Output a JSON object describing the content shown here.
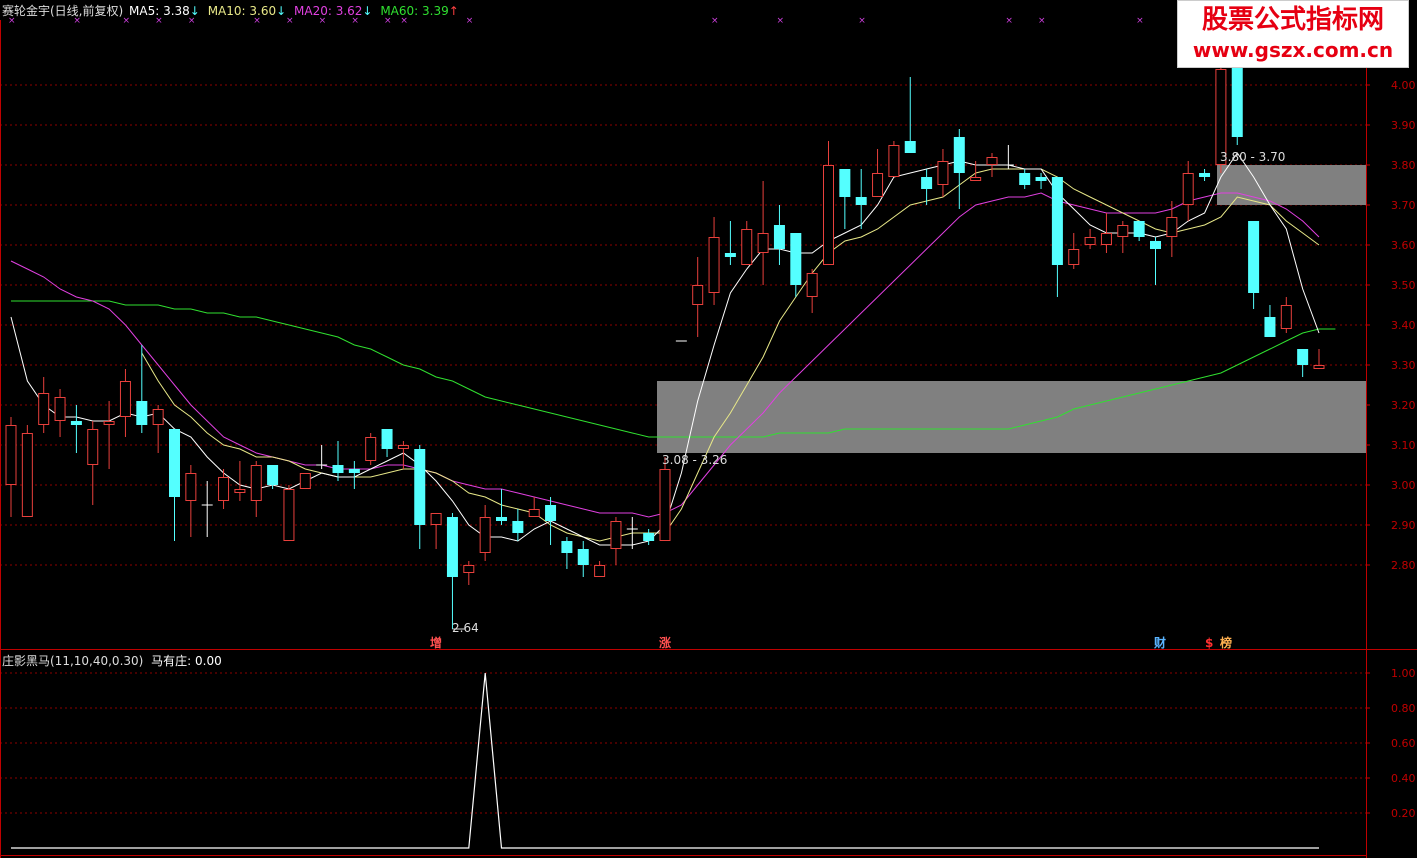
{
  "title_bar": {
    "stock_name": "赛轮金宇(日线,前复权)",
    "ma5": "MA5: 3.38",
    "ma10": "MA10: 3.60",
    "ma20": "MA20: 3.62",
    "ma60": "MA60: 3.39",
    "ma5_arrow": "↓",
    "ma10_arrow": "↓",
    "ma20_arrow": "↓",
    "ma60_arrow": "↑"
  },
  "colors": {
    "ma5": "#ffffff",
    "ma10": "#e8e888",
    "ma20": "#e040e0",
    "ma60": "#30e030",
    "up": "#e8403c",
    "down": "#54ffff",
    "grid": "#8b0000",
    "axis": "#c00000"
  },
  "watermark": {
    "line1": "股票公式指标网",
    "line2": "www.gszx.com.cn"
  },
  "price_axis": [
    "4.00",
    "3.90",
    "3.80",
    "3.70",
    "3.60",
    "3.50",
    "3.40",
    "3.30",
    "3.20",
    "3.10",
    "3.00",
    "2.90",
    "2.80"
  ],
  "indicator_axis": [
    "1.00",
    "0.80",
    "0.60",
    "0.40",
    "0.20"
  ],
  "zones": {
    "upper_label": "3.80 - 3.70",
    "lower_label": "3.08 - 3.26",
    "low_label": "2.64"
  },
  "event_markers": [
    {
      "text": "增"
    },
    {
      "text": "涨"
    },
    {
      "text": "财"
    },
    {
      "text": "$"
    },
    {
      "text": "榜"
    }
  ],
  "indicator": {
    "name": "庄影黑马(11,10,40,0.30)",
    "value": "马有庄: 0.00"
  },
  "candles": [
    [
      3.0,
      3.15,
      3.17,
      2.92
    ],
    [
      2.92,
      3.13,
      3.15,
      2.92
    ],
    [
      3.15,
      3.23,
      3.27,
      3.13
    ],
    [
      3.16,
      3.22,
      3.24,
      3.12
    ],
    [
      3.16,
      3.15,
      3.2,
      3.08
    ],
    [
      3.05,
      3.14,
      3.16,
      2.95
    ],
    [
      3.15,
      3.16,
      3.21,
      3.04
    ],
    [
      3.17,
      3.26,
      3.29,
      3.12
    ],
    [
      3.21,
      3.15,
      3.35,
      3.13
    ],
    [
      3.15,
      3.19,
      3.2,
      3.08
    ],
    [
      3.14,
      2.97,
      3.14,
      2.86
    ],
    [
      2.96,
      3.03,
      3.05,
      2.87
    ],
    [
      2.95,
      2.95,
      3.01,
      2.87
    ],
    [
      2.96,
      3.02,
      3.04,
      2.94
    ],
    [
      2.98,
      2.99,
      3.06,
      2.96
    ],
    [
      2.96,
      3.05,
      3.06,
      2.92
    ],
    [
      3.05,
      3.0,
      3.05,
      2.99
    ],
    [
      2.86,
      2.99,
      3.0,
      2.86
    ],
    [
      2.99,
      3.03,
      3.03,
      2.99
    ],
    [
      3.05,
      3.05,
      3.1,
      3.04
    ],
    [
      3.05,
      3.03,
      3.11,
      3.01
    ],
    [
      3.04,
      3.03,
      3.06,
      2.99
    ],
    [
      3.06,
      3.12,
      3.13,
      3.05
    ],
    [
      3.14,
      3.09,
      3.14,
      3.07
    ],
    [
      3.09,
      3.1,
      3.11,
      3.04
    ],
    [
      3.09,
      2.9,
      3.1,
      2.84
    ],
    [
      2.9,
      2.93,
      2.93,
      2.84
    ],
    [
      2.92,
      2.77,
      2.93,
      2.64
    ],
    [
      2.78,
      2.8,
      2.81,
      2.75
    ],
    [
      2.83,
      2.92,
      2.95,
      2.81
    ],
    [
      2.92,
      2.91,
      2.99,
      2.9
    ],
    [
      2.91,
      2.88,
      2.94,
      2.86
    ],
    [
      2.92,
      2.94,
      2.97,
      2.92
    ],
    [
      2.95,
      2.91,
      2.97,
      2.85
    ],
    [
      2.86,
      2.83,
      2.87,
      2.79
    ],
    [
      2.84,
      2.8,
      2.86,
      2.77
    ],
    [
      2.77,
      2.8,
      2.81,
      2.77
    ],
    [
      2.84,
      2.91,
      2.92,
      2.8
    ],
    [
      2.89,
      2.89,
      2.92,
      2.84
    ],
    [
      2.88,
      2.86,
      2.89,
      2.85
    ],
    [
      2.86,
      3.04,
      3.07,
      2.86
    ],
    [
      3.36,
      3.36,
      3.36,
      3.36
    ],
    [
      3.45,
      3.5,
      3.57,
      3.37
    ],
    [
      3.48,
      3.62,
      3.67,
      3.45
    ],
    [
      3.58,
      3.57,
      3.66,
      3.55
    ],
    [
      3.55,
      3.64,
      3.66,
      3.55
    ],
    [
      3.58,
      3.63,
      3.76,
      3.5
    ],
    [
      3.65,
      3.59,
      3.7,
      3.55
    ],
    [
      3.63,
      3.5,
      3.63,
      3.47
    ],
    [
      3.47,
      3.53,
      3.54,
      3.43
    ],
    [
      3.55,
      3.8,
      3.86,
      3.55
    ],
    [
      3.79,
      3.72,
      3.79,
      3.64
    ],
    [
      3.72,
      3.7,
      3.79,
      3.64
    ],
    [
      3.72,
      3.78,
      3.84,
      3.72
    ],
    [
      3.77,
      3.85,
      3.86,
      3.78
    ],
    [
      3.86,
      3.83,
      4.02,
      3.83
    ],
    [
      3.77,
      3.74,
      3.79,
      3.7
    ],
    [
      3.75,
      3.81,
      3.84,
      3.72
    ],
    [
      3.87,
      3.78,
      3.89,
      3.69
    ],
    [
      3.76,
      3.77,
      3.81,
      3.76
    ],
    [
      3.8,
      3.82,
      3.83,
      3.77
    ],
    [
      3.8,
      3.8,
      3.85,
      3.79
    ],
    [
      3.78,
      3.75,
      3.79,
      3.74
    ],
    [
      3.77,
      3.76,
      3.78,
      3.74
    ],
    [
      3.77,
      3.55,
      3.77,
      3.47
    ],
    [
      3.55,
      3.59,
      3.63,
      3.54
    ],
    [
      3.6,
      3.62,
      3.64,
      3.59
    ],
    [
      3.6,
      3.63,
      3.68,
      3.58
    ],
    [
      3.62,
      3.65,
      3.66,
      3.58
    ],
    [
      3.66,
      3.62,
      3.66,
      3.61
    ],
    [
      3.61,
      3.59,
      3.62,
      3.5
    ],
    [
      3.62,
      3.67,
      3.71,
      3.57
    ],
    [
      3.7,
      3.78,
      3.81,
      3.66
    ],
    [
      3.78,
      3.77,
      3.79,
      3.76
    ],
    [
      3.8,
      4.04,
      4.05,
      3.78
    ],
    [
      4.06,
      3.87,
      4.1,
      3.85
    ],
    [
      3.66,
      3.48,
      3.66,
      3.44
    ],
    [
      3.42,
      3.37,
      3.45,
      3.37
    ],
    [
      3.39,
      3.45,
      3.47,
      3.38
    ],
    [
      3.34,
      3.3,
      3.34,
      3.27
    ],
    [
      3.29,
      3.3,
      3.34,
      3.29
    ]
  ],
  "ma5_series": [
    3.42,
    3.26,
    3.2,
    3.17,
    3.17,
    3.16,
    3.16,
    3.18,
    3.17,
    3.18,
    3.14,
    3.12,
    3.07,
    3.03,
    3.0,
    2.99,
    3.0,
    2.99,
    3.01,
    3.03,
    3.02,
    3.02,
    3.04,
    3.06,
    3.08,
    3.05,
    3.01,
    2.96,
    2.9,
    2.87,
    2.87,
    2.86,
    2.89,
    2.91,
    2.89,
    2.87,
    2.85,
    2.85,
    2.85,
    2.86,
    2.9,
    3.03,
    3.21,
    3.35,
    3.48,
    3.54,
    3.59,
    3.59,
    3.58,
    3.58,
    3.61,
    3.63,
    3.65,
    3.7,
    3.77,
    3.78,
    3.79,
    3.8,
    3.81,
    3.8,
    3.8,
    3.8,
    3.79,
    3.79,
    3.73,
    3.69,
    3.65,
    3.63,
    3.63,
    3.63,
    3.62,
    3.63,
    3.66,
    3.68,
    3.77,
    3.83,
    3.77,
    3.7,
    3.64,
    3.49,
    3.38
  ],
  "ma10_series": [
    null,
    null,
    null,
    null,
    null,
    null,
    null,
    null,
    3.33,
    3.26,
    3.2,
    3.17,
    3.13,
    3.1,
    3.09,
    3.07,
    3.07,
    3.06,
    3.04,
    3.03,
    3.02,
    3.02,
    3.02,
    3.03,
    3.04,
    3.04,
    3.03,
    3.01,
    2.98,
    2.97,
    2.95,
    2.94,
    2.93,
    2.9,
    2.88,
    2.87,
    2.86,
    2.87,
    2.88,
    2.88,
    2.88,
    2.94,
    3.03,
    3.12,
    3.18,
    3.25,
    3.32,
    3.41,
    3.47,
    3.53,
    3.58,
    3.61,
    3.62,
    3.64,
    3.67,
    3.7,
    3.71,
    3.72,
    3.75,
    3.78,
    3.79,
    3.79,
    3.79,
    3.79,
    3.77,
    3.74,
    3.72,
    3.7,
    3.68,
    3.66,
    3.64,
    3.63,
    3.64,
    3.65,
    3.67,
    3.72,
    3.71,
    3.7,
    3.66,
    3.63,
    3.6
  ],
  "ma20_series": [
    3.56,
    3.54,
    3.52,
    3.49,
    3.47,
    3.46,
    3.44,
    3.4,
    3.35,
    3.3,
    3.25,
    3.2,
    3.16,
    3.12,
    3.1,
    3.08,
    3.07,
    3.06,
    3.05,
    3.05,
    3.04,
    3.04,
    3.04,
    3.05,
    3.05,
    3.04,
    3.03,
    3.01,
    3.0,
    2.99,
    2.99,
    2.98,
    2.97,
    2.96,
    2.95,
    2.94,
    2.93,
    2.93,
    2.93,
    2.92,
    2.93,
    2.95,
    3.0,
    3.05,
    3.1,
    3.14,
    3.18,
    3.23,
    3.27,
    3.31,
    3.35,
    3.39,
    3.43,
    3.47,
    3.51,
    3.55,
    3.59,
    3.63,
    3.67,
    3.7,
    3.71,
    3.72,
    3.72,
    3.73,
    3.71,
    3.7,
    3.69,
    3.68,
    3.68,
    3.68,
    3.68,
    3.69,
    3.71,
    3.72,
    3.73,
    3.73,
    3.72,
    3.71,
    3.69,
    3.66,
    3.62
  ],
  "ma60_series": [
    3.46,
    3.46,
    3.46,
    3.46,
    3.46,
    3.46,
    3.46,
    3.45,
    3.45,
    3.45,
    3.44,
    3.44,
    3.43,
    3.43,
    3.42,
    3.42,
    3.41,
    3.4,
    3.39,
    3.38,
    3.37,
    3.35,
    3.34,
    3.32,
    3.3,
    3.29,
    3.27,
    3.26,
    3.24,
    3.22,
    3.21,
    3.2,
    3.19,
    3.18,
    3.17,
    3.16,
    3.15,
    3.14,
    3.13,
    3.12,
    3.12,
    3.12,
    3.12,
    3.12,
    3.12,
    3.12,
    3.12,
    3.13,
    3.13,
    3.13,
    3.13,
    3.14,
    3.14,
    3.14,
    3.14,
    3.14,
    3.14,
    3.14,
    3.14,
    3.14,
    3.14,
    3.14,
    3.15,
    3.16,
    3.17,
    3.19,
    3.2,
    3.21,
    3.22,
    3.23,
    3.24,
    3.25,
    3.26,
    3.27,
    3.28,
    3.3,
    3.32,
    3.34,
    3.36,
    3.38,
    3.39,
    3.39
  ],
  "indicator_series": [
    0,
    0,
    0,
    0,
    0,
    0,
    0,
    0,
    0,
    0,
    0,
    0,
    0,
    0,
    0,
    0,
    0,
    0,
    0,
    0,
    0,
    0,
    0,
    0,
    0,
    0,
    0,
    0,
    0,
    1,
    0,
    0,
    0,
    0,
    0,
    0,
    0,
    0,
    0,
    0,
    0,
    0,
    0,
    0,
    0,
    0,
    0,
    0,
    0,
    0,
    0,
    0,
    0,
    0,
    0,
    0,
    0,
    0,
    0,
    0,
    0,
    0,
    0,
    0,
    0,
    0,
    0,
    0,
    0,
    0,
    0,
    0,
    0,
    0,
    0,
    0,
    0,
    0,
    0,
    0,
    0
  ]
}
